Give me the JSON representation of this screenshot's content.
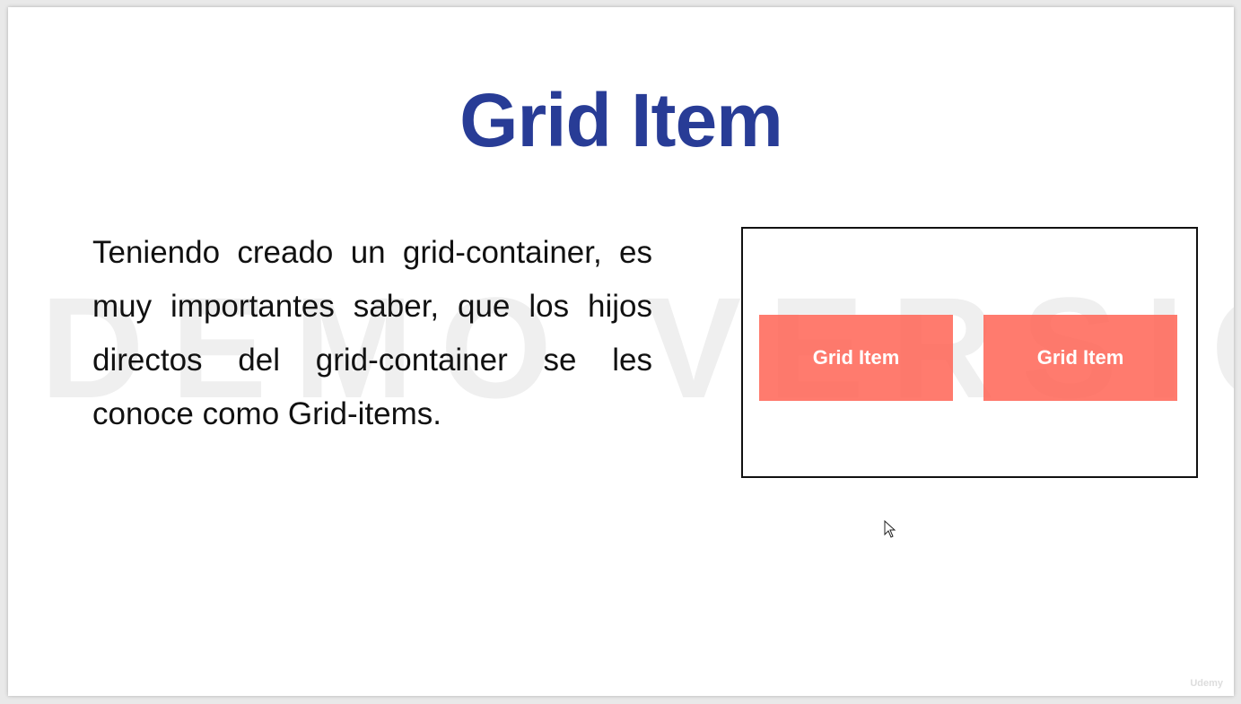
{
  "title": "Grid Item",
  "watermark": "DEMO VERSION",
  "paragraph": "Teniendo creado un grid-container, es muy importantes saber, que los hijos directos del grid-container se les conoce como Grid-items.",
  "grid_items": [
    "Grid Item",
    "Grid Item"
  ],
  "logo": "Udemy"
}
